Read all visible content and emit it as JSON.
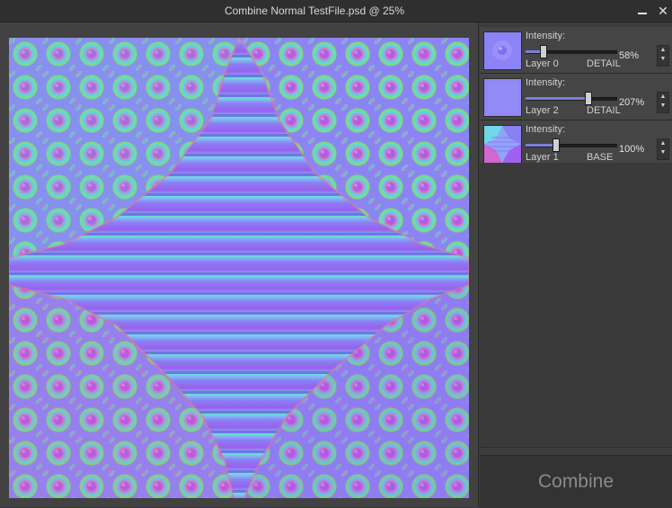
{
  "window": {
    "title": "Combine Normal TestFile.psd @ 25%",
    "minimize_symbol": "—",
    "close_symbol": "✕"
  },
  "layers": [
    {
      "intensity_label": "Intensity:",
      "value": 58,
      "value_text": "58%",
      "max": 300,
      "name": "Layer 0",
      "type": "DETAIL",
      "thumb": "flower-detail"
    },
    {
      "intensity_label": "Intensity:",
      "value": 207,
      "value_text": "207%",
      "max": 300,
      "name": "Layer 2",
      "type": "DETAIL",
      "thumb": "plain-detail"
    },
    {
      "intensity_label": "Intensity:",
      "value": 100,
      "value_text": "100%",
      "max": 300,
      "name": "Layer 1",
      "type": "BASE",
      "thumb": "base-shape"
    }
  ],
  "spinner": {
    "up": "▲",
    "down": "▼"
  },
  "combine_label": "Combine",
  "colors": {
    "normal_blue": "#8a80f5",
    "normal_purple": "#a060f0",
    "normal_cyan": "#60d8f0",
    "normal_green": "#70e060",
    "normal_pink": "#e060c0",
    "accent": "#7a7fd8"
  }
}
